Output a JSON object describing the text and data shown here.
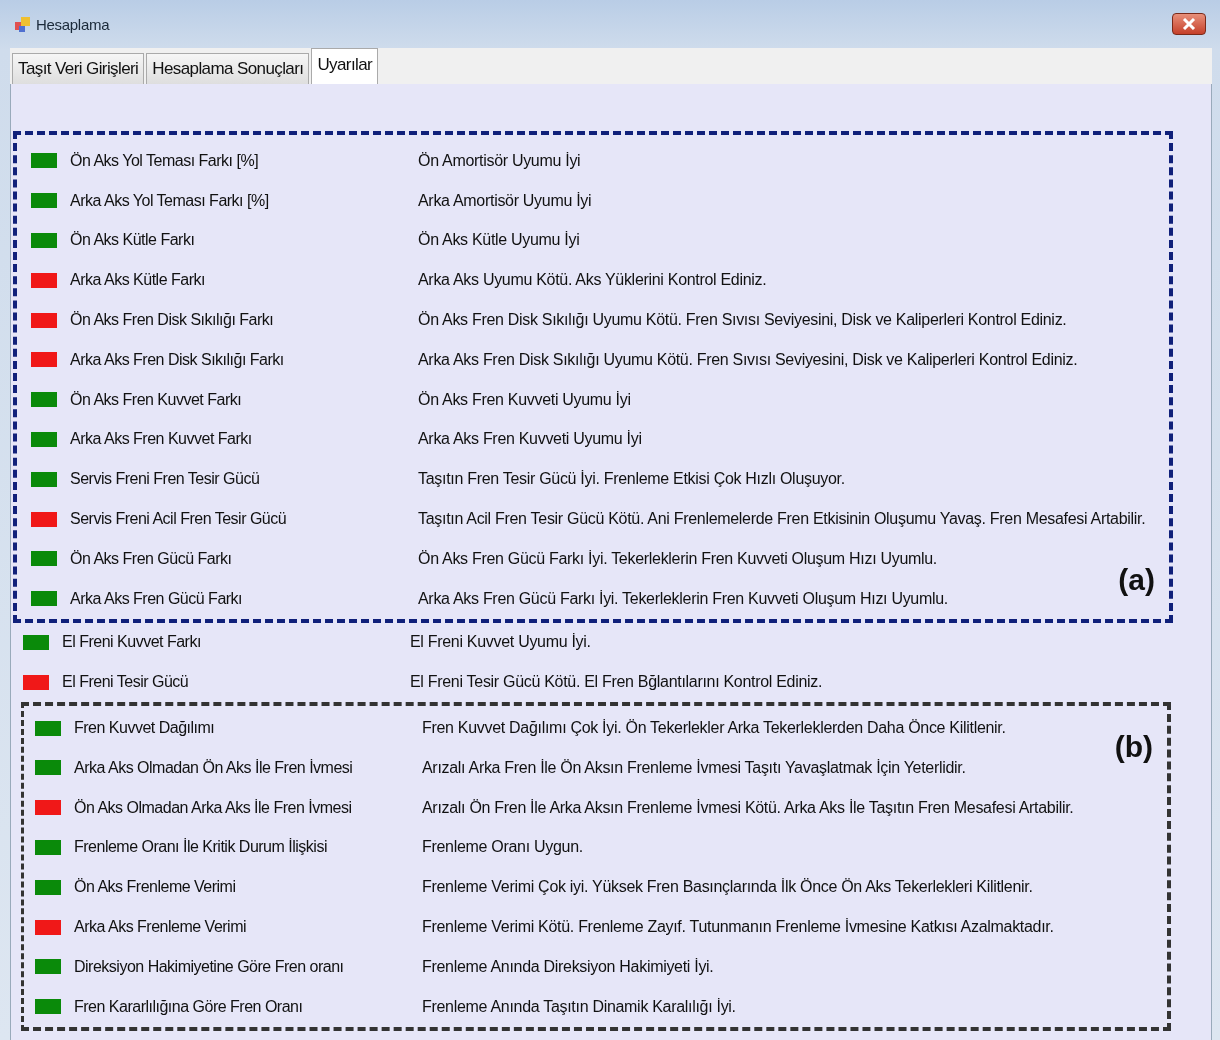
{
  "window": {
    "title": "Hesaplama"
  },
  "tabs": [
    {
      "label": "Taşıt Veri Girişleri",
      "selected": false
    },
    {
      "label": "Hesaplama Sonuçları",
      "selected": false
    },
    {
      "label": "Uyarılar",
      "selected": true
    }
  ],
  "groups": [
    {
      "annotation": "(a)",
      "kind": "navy",
      "rows": [
        {
          "color": "#0a8a0a",
          "label": "Ön Aks Yol Teması Farkı [%]",
          "message": "Ön Amortisör Uyumu İyi"
        },
        {
          "color": "#0a8a0a",
          "label": "Arka Aks Yol Teması Farkı [%]",
          "message": "Arka Amortisör Uyumu İyi"
        },
        {
          "color": "#0a8a0a",
          "label": "Ön Aks Kütle Farkı",
          "message": "Ön Aks Kütle Uyumu İyi"
        },
        {
          "color": "#f01818",
          "label": "Arka Aks Kütle Farkı",
          "message": "Arka Aks Uyumu Kötü. Aks Yüklerini Kontrol Ediniz."
        },
        {
          "color": "#f01818",
          "label": "Ön Aks Fren Disk Sıkılığı Farkı",
          "message": "Ön Aks Fren Disk Sıkılığı Uyumu Kötü. Fren Sıvısı Seviyesini, Disk ve Kaliperleri Kontrol Ediniz."
        },
        {
          "color": "#f01818",
          "label": "Arka Aks Fren Disk Sıkılığı Farkı",
          "message": "Arka Aks Fren Disk Sıkılığı Uyumu Kötü. Fren Sıvısı Seviyesini, Disk ve Kaliperleri Kontrol Ediniz."
        },
        {
          "color": "#0a8a0a",
          "label": "Ön Aks Fren Kuvvet Farkı",
          "message": "Ön Aks Fren Kuvveti Uyumu İyi"
        },
        {
          "color": "#0a8a0a",
          "label": "Arka Aks Fren Kuvvet Farkı",
          "message": "Arka Aks Fren Kuvveti Uyumu İyi"
        },
        {
          "color": "#0a8a0a",
          "label": "Servis Freni Fren Tesir Gücü",
          "message": "Taşıtın Fren Tesir Gücü İyi. Frenleme Etkisi Çok Hızlı Oluşuyor."
        },
        {
          "color": "#f01818",
          "label": "Servis Freni Acil Fren Tesir Gücü",
          "message": "Taşıtın Acil Fren Tesir Gücü Kötü. Ani Frenlemelerde Fren Etkisinin Oluşumu Yavaş. Fren Mesafesi Artabilir."
        },
        {
          "color": "#0a8a0a",
          "label": "Ön Aks Fren Gücü Farkı",
          "message": "Ön Aks Fren Gücü Farkı İyi. Tekerleklerin Fren Kuvveti Oluşum Hızı Uyumlu."
        },
        {
          "color": "#0a8a0a",
          "label": "Arka Aks Fren Gücü Farkı",
          "message": "Arka Aks Fren Gücü Farkı İyi. Tekerleklerin Fren Kuvveti Oluşum Hızı Uyumlu."
        }
      ]
    },
    {
      "kind": "plain",
      "rows": [
        {
          "color": "#0a8a0a",
          "label": "El Freni Kuvvet Farkı",
          "message": "El Freni Kuvvet Uyumu İyi."
        },
        {
          "color": "#f01818",
          "label": "El Freni Tesir  Gücü",
          "message": "El Freni Tesir Gücü Kötü. El Fren Bğlantılarını Kontrol Ediniz."
        }
      ]
    },
    {
      "annotation": "(b)",
      "kind": "dark",
      "rows": [
        {
          "color": "#0a8a0a",
          "label": "Fren Kuvvet Dağılımı",
          "message": "Fren Kuvvet Dağılımı Çok İyi. Ön Tekerlekler Arka Tekerleklerden Daha Önce Kilitlenir."
        },
        {
          "color": "#0a8a0a",
          "label": "Arka Aks Olmadan Ön Aks İle Fren İvmesi",
          "message": "Arızalı Arka Fren İle Ön Aksın Frenleme İvmesi Taşıtı Yavaşlatmak İçin Yeterlidir."
        },
        {
          "color": "#f01818",
          "label": "Ön Aks Olmadan Arka Aks İle Fren İvmesi",
          "message": "Arızalı Ön Fren İle Arka Aksın Frenleme İvmesi Kötü. Arka Aks İle Taşıtın Fren Mesafesi Artabilir."
        },
        {
          "color": "#0a8a0a",
          "label": "Frenleme Oranı İle Kritik Durum İlişkisi",
          "message": "Frenleme Oranı Uygun."
        },
        {
          "color": "#0a8a0a",
          "label": "Ön Aks Frenleme Verimi",
          "message": "Frenleme Verimi Çok iyi. Yüksek Fren Basınçlarında İlk Önce Ön Aks Tekerlekleri Kilitlenir."
        },
        {
          "color": "#f01818",
          "label": "Arka Aks Frenleme Verimi",
          "message": "Frenleme Verimi Kötü. Frenleme Zayıf. Tutunmanın Frenleme İvmesine Katkısı Azalmaktadır."
        },
        {
          "color": "#0a8a0a",
          "label": "Direksiyon Hakimiyetine Göre Fren oranı",
          "message": "Frenleme Anında Direksiyon Hakimiyeti İyi."
        },
        {
          "color": "#0a8a0a",
          "label": "Fren Kararlılığına Göre Fren Oranı",
          "message": "Frenleme Anında Taşıtın Dinamik Karalılığı İyi."
        }
      ]
    }
  ]
}
